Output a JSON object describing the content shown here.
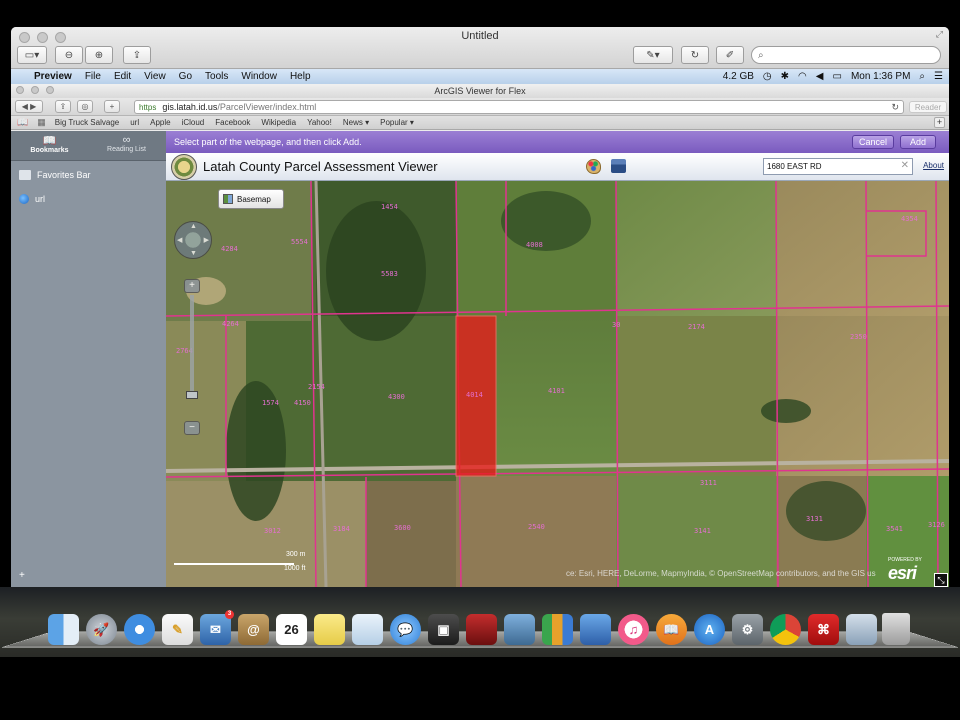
{
  "preview": {
    "title": "Untitled",
    "search_placeholder": "",
    "menubar": {
      "app": "Preview",
      "items": [
        "File",
        "Edit",
        "View",
        "Go",
        "Tools",
        "Window",
        "Help"
      ],
      "memory": "4.2 GB",
      "clock": "Mon 1:36 PM"
    }
  },
  "safari": {
    "title": "ArcGIS Viewer for Flex",
    "url_scheme": "https",
    "url_host": "gis.latah.id.us",
    "url_path": "/ParcelViewer/index.html",
    "reader_label": "Reader",
    "favorites": [
      "Big Truck Salvage",
      "url",
      "Apple",
      "iCloud",
      "Facebook",
      "Wikipedia",
      "Yahoo!",
      "News ▾",
      "Popular ▾"
    ],
    "sidebar": {
      "tabs": [
        {
          "label": "Bookmarks",
          "icon": "book-icon"
        },
        {
          "label": "Reading List",
          "icon": "glasses-icon"
        }
      ],
      "items": [
        {
          "label": "Favorites Bar",
          "icon": "folder-icon"
        },
        {
          "label": "url",
          "icon": "globe-icon"
        }
      ],
      "add_label": "+"
    },
    "select_bar": {
      "message": "Select part of the webpage, and then click Add.",
      "cancel": "Cancel",
      "add": "Add"
    }
  },
  "app": {
    "title": "Latah County Parcel Assessment Viewer",
    "search_value": "1680 EAST RD",
    "about": "About",
    "basemap": "Basemap",
    "scale_m": "300 m",
    "scale_ft": "1000 ft",
    "attribution": "ce: Esri, HERE, DeLorme, MapmyIndia, © OpenStreetMap contributors, and the GIS us",
    "esri_powered": "POWERED BY",
    "esri_logo": "esri",
    "parcel_labels": [
      "1454",
      "5554",
      "4008",
      "4284",
      "4354",
      "5583",
      "4264",
      "2764",
      "2174",
      "1574",
      "4150",
      "4300",
      "2154",
      "4014",
      "4101",
      "3012",
      "3184",
      "3600",
      "2540",
      "3141",
      "3131",
      "3541",
      "3126",
      "2404",
      "3111",
      "30",
      "2350"
    ],
    "highlight_color": "#e8201e",
    "parcel_line_color": "#e0348f"
  },
  "dock": {
    "calendar_day": "26",
    "mail_badge": "3",
    "icons": [
      "finder-icon",
      "launchpad-icon",
      "safari-icon",
      "textedit-icon",
      "mail-icon",
      "contacts-icon",
      "calendar-icon",
      "notes-icon",
      "preview-icon",
      "messages-icon",
      "facetime-icon",
      "photobooth-icon",
      "iphoto-icon",
      "numbers-icon",
      "keynote-icon",
      "itunes-icon",
      "ibooks-icon",
      "appstore-icon",
      "system-preferences-icon",
      "chrome-icon",
      "acrobat-icon",
      "preview-icon-2"
    ]
  }
}
